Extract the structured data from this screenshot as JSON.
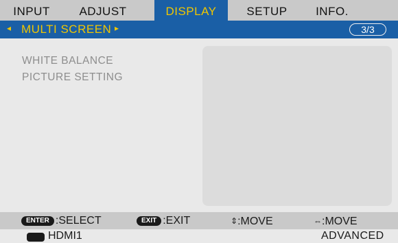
{
  "tabs": [
    {
      "label": "INPUT",
      "active": false
    },
    {
      "label": "ADJUST",
      "active": false
    },
    {
      "label": "DISPLAY",
      "active": true
    },
    {
      "label": "SETUP",
      "active": false
    },
    {
      "label": "INFO.",
      "active": false
    }
  ],
  "submenu": {
    "left_arrow": "◂",
    "title": "MULTI SCREEN",
    "right_arrow": "▸",
    "page_indicator": "3/3"
  },
  "menu_items": [
    {
      "label": "WHITE BALANCE"
    },
    {
      "label": "PICTURE SETTING"
    }
  ],
  "guide": {
    "enter_key": "ENTER",
    "enter_action": ":SELECT",
    "exit_key": "EXIT",
    "exit_action": ":EXIT",
    "updown_glyph": "⇕",
    "updown_action": ":MOVE",
    "leftright_glyph": "⇔",
    "leftright_action": ":MOVE"
  },
  "status": {
    "input_icon": "hdmi-icon",
    "input": "HDMI1",
    "mode": "ADVANCED"
  },
  "colors": {
    "accent_blue": "#1a5fa6",
    "highlight_yellow": "#f0c600",
    "bar_gray": "#c9c9c9",
    "panel_gray": "#e9e9e9"
  }
}
